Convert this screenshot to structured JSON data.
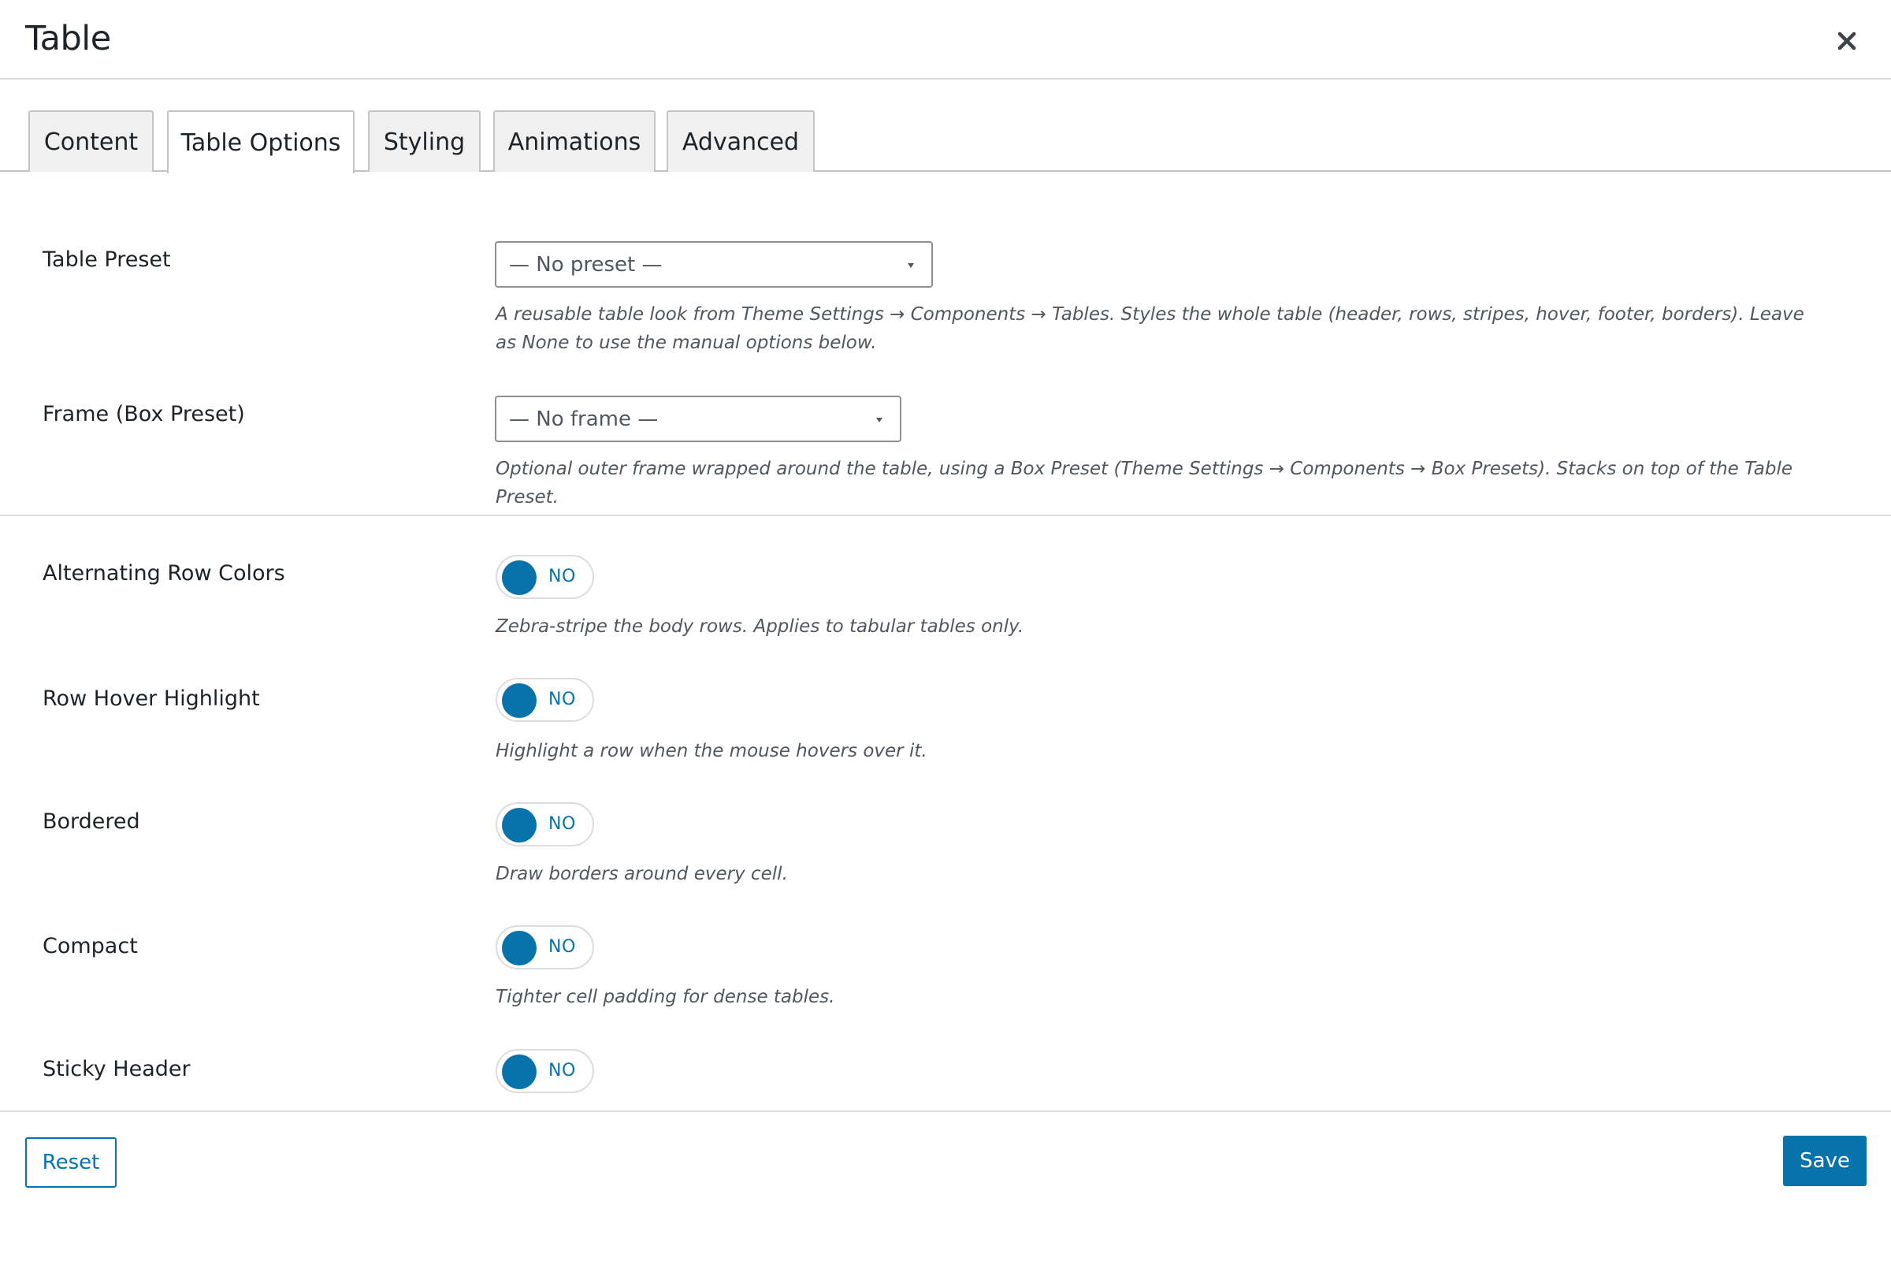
{
  "modal": {
    "title": "Table",
    "close_icon": "close-icon"
  },
  "tabs": [
    {
      "label": "Content",
      "active": false
    },
    {
      "label": "Table Options",
      "active": true
    },
    {
      "label": "Styling",
      "active": false
    },
    {
      "label": "Animations",
      "active": false
    },
    {
      "label": "Advanced",
      "active": false
    }
  ],
  "presets": {
    "table_preset": {
      "label": "Table Preset",
      "value": "— No preset —",
      "description": "A reusable table look from Theme Settings → Components → Tables. Styles the whole table (header, rows, stripes, hover, footer, borders). Leave as None to use the manual options below."
    },
    "frame_preset": {
      "label": "Frame (Box Preset)",
      "value": "— No frame —",
      "description": "Optional outer frame wrapped around the table, using a Box Preset (Theme Settings → Components → Box Presets). Stacks on top of the Table Preset."
    }
  },
  "options": [
    {
      "label": "Alternating Row Colors",
      "state": "NO",
      "description": "Zebra-stripe the body rows. Applies to tabular tables only."
    },
    {
      "label": "Row Hover Highlight",
      "state": "NO",
      "description": "Highlight a row when the mouse hovers over it."
    },
    {
      "label": "Bordered",
      "state": "NO",
      "description": "Draw borders around every cell."
    },
    {
      "label": "Compact",
      "state": "NO",
      "description": "Tighter cell padding for dense tables."
    },
    {
      "label": "Sticky Header",
      "state": "NO",
      "description": ""
    }
  ],
  "footer": {
    "reset_label": "Reset",
    "save_label": "Save"
  },
  "colors": {
    "accent": "#0873aa",
    "border": "#dcdcde",
    "text": "#1d2327",
    "muted": "#50575e"
  }
}
